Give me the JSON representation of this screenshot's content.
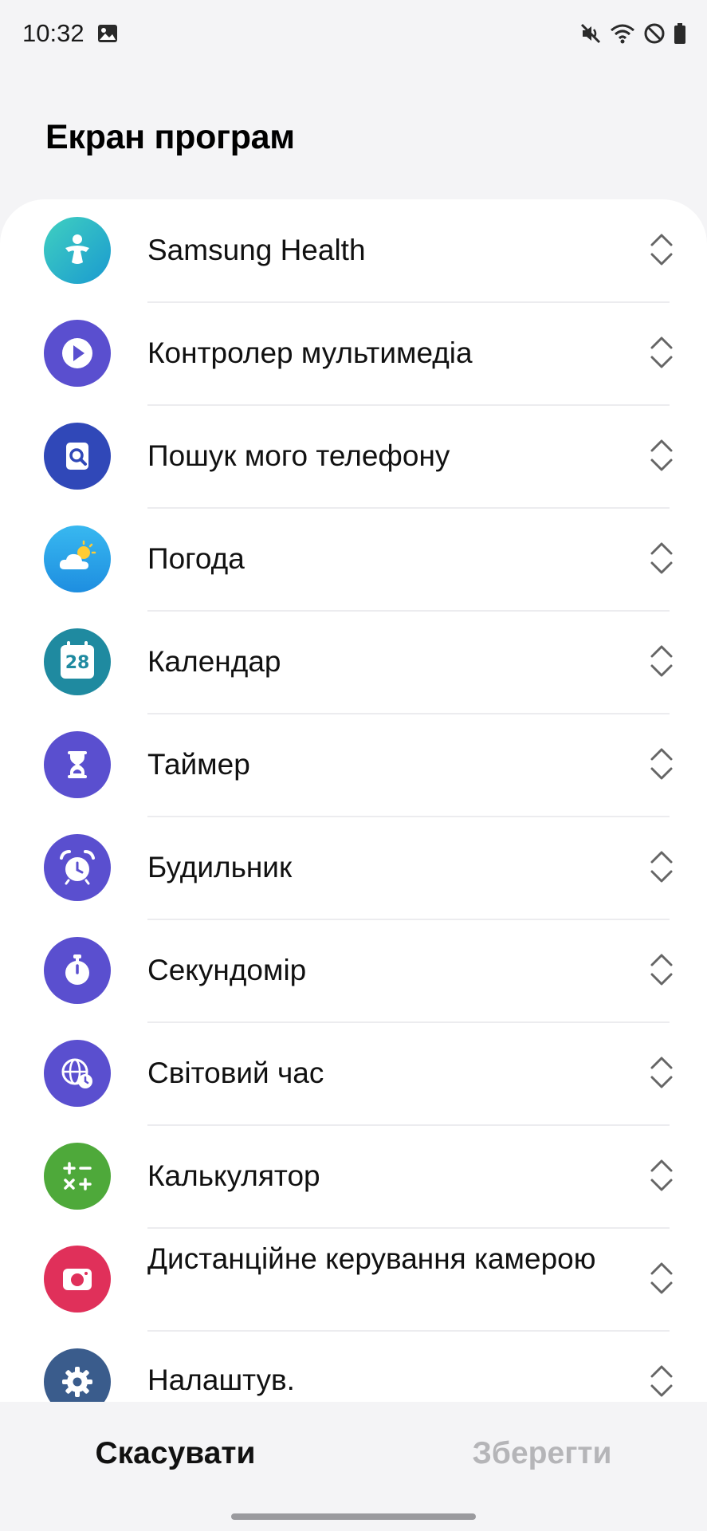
{
  "status_bar": {
    "time": "10:32",
    "icons": [
      "gallery-icon",
      "vibrate-icon",
      "wifi-icon",
      "do-not-disturb-icon",
      "battery-icon"
    ]
  },
  "page_title": "Екран програм",
  "apps": [
    {
      "label": "Samsung Health",
      "icon": "samsung-health-icon",
      "color": "#2ab4b0"
    },
    {
      "label": "Контролер мультимедіа",
      "icon": "play-icon",
      "color": "#5a4fcf"
    },
    {
      "label": "Пошук мого телефону",
      "icon": "find-phone-icon",
      "color": "#3048b8"
    },
    {
      "label": "Погода",
      "icon": "weather-icon",
      "color": "#2aa4e8"
    },
    {
      "label": "Календар",
      "icon": "calendar-icon",
      "color": "#1f8aa0",
      "badge": "28"
    },
    {
      "label": "Таймер",
      "icon": "hourglass-icon",
      "color": "#5a4fcf"
    },
    {
      "label": "Будильник",
      "icon": "alarm-clock-icon",
      "color": "#5a4fcf"
    },
    {
      "label": "Секундомір",
      "icon": "stopwatch-icon",
      "color": "#5a4fcf"
    },
    {
      "label": "Світовий час",
      "icon": "world-clock-icon",
      "color": "#5a4fcf"
    },
    {
      "label": "Калькулятор",
      "icon": "calculator-icon",
      "color": "#4ea93a"
    },
    {
      "label": "Дистанційне керування камерою",
      "icon": "camera-icon",
      "color": "#e0305a"
    },
    {
      "label": "Налаштув.",
      "icon": "settings-gear-icon",
      "color": "#3a5c8c"
    }
  ],
  "buttons": {
    "cancel": "Скасувати",
    "save": "Зберегти"
  },
  "colors": {
    "background": "#f4f4f6",
    "card": "#ffffff",
    "save_disabled": "#b5b5b8"
  }
}
